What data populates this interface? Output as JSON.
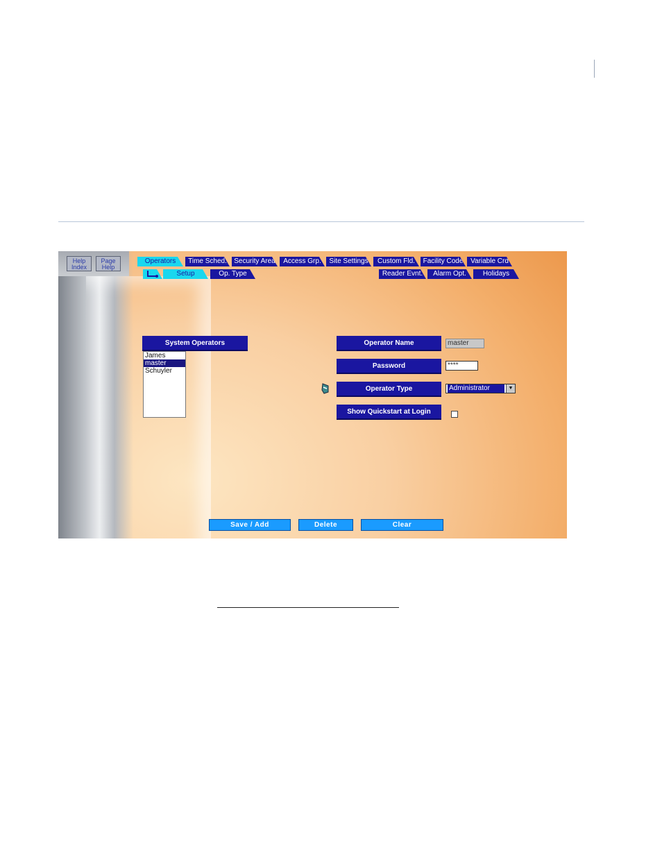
{
  "help": {
    "index_label": "Help Index",
    "page_label": "Page Help"
  },
  "tabs_top": [
    {
      "label": "Operators",
      "active": true
    },
    {
      "label": "Time Sched."
    },
    {
      "label": "Security Area"
    },
    {
      "label": "Access Grp."
    },
    {
      "label": "Site Settings"
    },
    {
      "label": "Custom Fld."
    },
    {
      "label": "Facility Code"
    },
    {
      "label": "Variable Crd"
    }
  ],
  "tabs_sub": [
    {
      "label": "Setup",
      "active": true
    },
    {
      "label": "Op. Type"
    },
    {
      "label": "Reader Evnt."
    },
    {
      "label": "Alarm Opt."
    },
    {
      "label": "Holidays"
    }
  ],
  "system_operators": {
    "header": "System Operators",
    "items": [
      "James",
      "master",
      "Schuyler"
    ],
    "selected": "master"
  },
  "form": {
    "operator_name_label": "Operator Name",
    "operator_name_value": "master",
    "password_label": "Password",
    "password_value": "****",
    "operator_type_label": "Operator Type",
    "operator_type_value": "Administrator",
    "quickstart_label": "Show Quickstart at Login",
    "quickstart_checked": false
  },
  "actions": {
    "save": "Save / Add",
    "delete": "Delete",
    "clear": "Clear"
  },
  "colors": {
    "label_bg": "#1a16a0",
    "tab_active": "#19d7ee",
    "button_bg": "#1a9bff",
    "accent_orange": "#eb9446"
  }
}
